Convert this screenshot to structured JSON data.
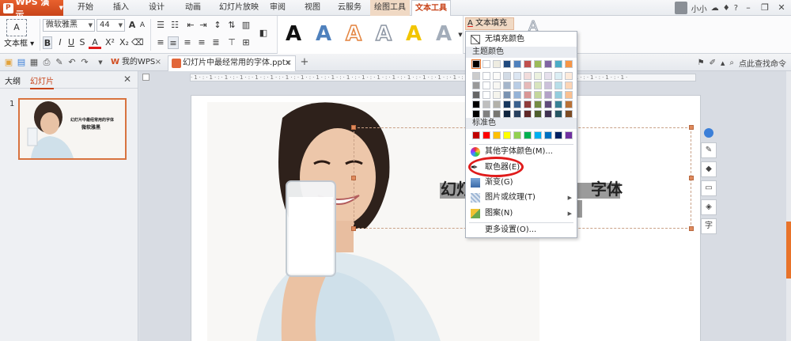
{
  "app": {
    "name": "WPS 演示"
  },
  "menu_tabs": [
    "开始",
    "插入",
    "设计",
    "动画",
    "幻灯片放映",
    "审阅",
    "视图",
    "云服务",
    "绘图工具",
    "文本工具"
  ],
  "user": {
    "name": "小小"
  },
  "ribbon": {
    "textbox_label": "文本框",
    "font_name": "微软雅黑",
    "font_size": "44",
    "fill_button": "文本填充"
  },
  "qbar": {
    "tabs": [
      {
        "label": "我的WPS"
      },
      {
        "label": "幻灯片中最经常用的字体.pptx *"
      }
    ],
    "search": "点此查找命令"
  },
  "leftpanel": {
    "tab_outline": "大纲",
    "tab_slides": "幻灯片",
    "slide_number": "1"
  },
  "slide": {
    "title_text": "幻灯片中最经常用的字体",
    "subtitle_text": "微软雅黑",
    "visible_left": "幻灯",
    "visible_right": "字体"
  },
  "dropdown": {
    "no_fill": "无填充颜色",
    "theme_colors": "主题颜色",
    "standard_colors": "标准色",
    "more_colors": "其他字体颜色(M)...",
    "eyedropper": "取色器(E)",
    "gradient": "渐变(G)",
    "picture_texture": "图片或纹理(T)",
    "pattern": "图案(N)",
    "more_settings": "更多设置(O)...",
    "theme_row": [
      "#000000",
      "#ffffff",
      "#eeece1",
      "#1f497d",
      "#4f81bd",
      "#c0504d",
      "#9bbb59",
      "#8064a2",
      "#4bacc6",
      "#f79646"
    ],
    "standard_row": [
      "#c00000",
      "#ff0000",
      "#ffc000",
      "#ffff00",
      "#92d050",
      "#00b050",
      "#00b0f0",
      "#0070c0",
      "#002060",
      "#7030a0"
    ]
  },
  "colors": {
    "accent": "#c8441a",
    "ring": "#e01b1b"
  }
}
